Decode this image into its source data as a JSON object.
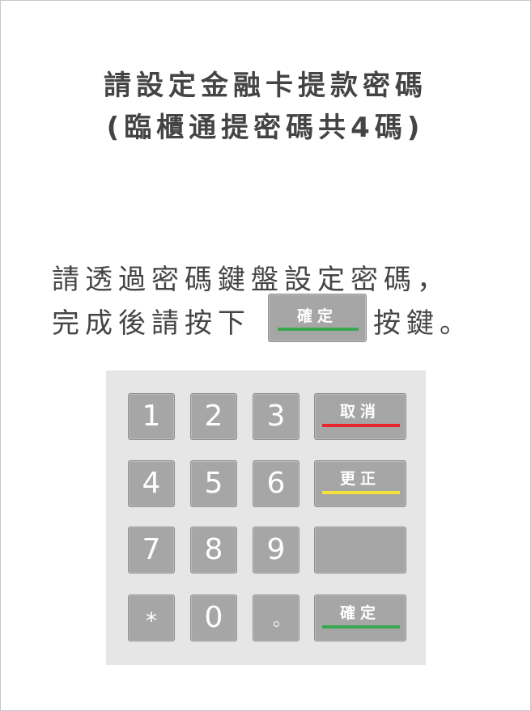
{
  "title": {
    "line1": "請設定金融卡提款密碼",
    "line2": "(臨櫃通提密碼共4碼)"
  },
  "instructions": {
    "line1": "請透過密碼鍵盤設定密碼，",
    "line2_prefix": "完成後請按下",
    "inline_key_label": "確定",
    "line2_suffix": "按鍵。"
  },
  "keypad": {
    "digits": [
      "1",
      "2",
      "3",
      "4",
      "5",
      "6",
      "7",
      "8",
      "9",
      "0"
    ],
    "star": "*",
    "cancel_label": "取消",
    "correct_label": "更正",
    "confirm_label": "確定"
  },
  "colors": {
    "cancel_bar": "#e8262b",
    "correct_bar": "#f2e23a",
    "confirm_bar": "#3aa850",
    "key_face": "#a6a6a6",
    "keypad_bg": "#e6e6e6",
    "text": "#444444"
  }
}
